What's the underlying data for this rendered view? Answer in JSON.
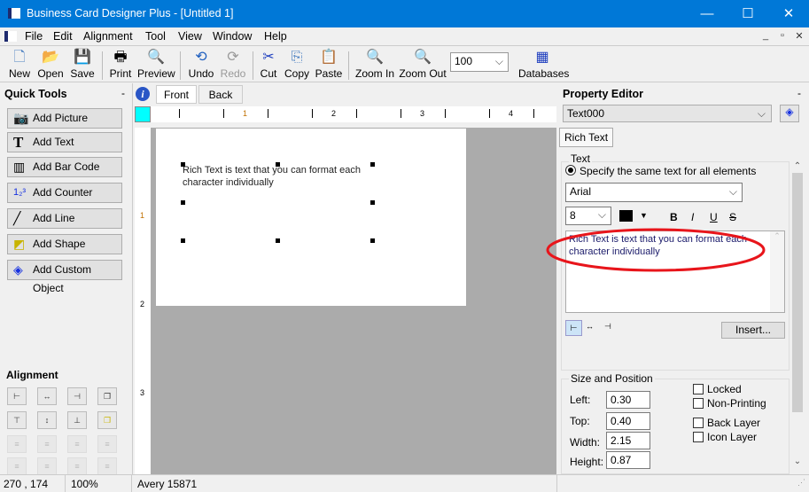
{
  "window": {
    "title": "Business Card Designer Plus  - [Untitled 1]",
    "minimize": "—",
    "maximize": "☐",
    "close": "✕"
  },
  "menu": [
    "File",
    "Edit",
    "Alignment",
    "Tool",
    "View",
    "Window",
    "Help"
  ],
  "mdi_controls": [
    "_",
    "▫",
    "✕"
  ],
  "toolbar": {
    "buttons": [
      {
        "label": "New",
        "icon": "new-file-icon"
      },
      {
        "label": "Open",
        "icon": "open-folder-icon"
      },
      {
        "label": "Save",
        "icon": "save-disk-icon"
      },
      {
        "label": "Print",
        "icon": "printer-icon"
      },
      {
        "label": "Preview",
        "icon": "preview-icon"
      },
      {
        "label": "Undo",
        "icon": "undo-icon"
      },
      {
        "label": "Redo",
        "icon": "redo-icon",
        "disabled": true
      },
      {
        "label": "Cut",
        "icon": "scissors-icon"
      },
      {
        "label": "Copy",
        "icon": "copy-icon"
      },
      {
        "label": "Paste",
        "icon": "paste-icon"
      },
      {
        "label": "Zoom In",
        "icon": "zoom-in-icon"
      },
      {
        "label": "Zoom Out",
        "icon": "zoom-out-icon"
      },
      {
        "label": "Databases",
        "icon": "database-icon"
      }
    ],
    "zoom_value": "100"
  },
  "quick_tools": {
    "title": "Quick Tools",
    "collapse": "-",
    "buttons": [
      "Add Picture",
      "Add Text",
      "Add Bar Code",
      "Add Counter",
      "Add Line",
      "Add Shape",
      "Add Custom Object"
    ],
    "alignment_title": "Alignment"
  },
  "canvas": {
    "tabs": [
      "Front",
      "Back"
    ],
    "active_tab": "Front",
    "ruler_h": [
      "1",
      "2",
      "3",
      "4"
    ],
    "ruler_v": [
      "1",
      "2",
      "3"
    ],
    "text": "Rich Text is text that you can format each character individually"
  },
  "property_editor": {
    "title": "Property Editor",
    "collapse": "-",
    "object": "Text000",
    "tab": "Rich Text",
    "text_group": "Text",
    "radio_label": "Specify the same text for all elements",
    "font": "Arial",
    "size": "8",
    "bold": "B",
    "italic": "I",
    "underline": "U",
    "strike": "S",
    "text_value": "Rich Text is text that you can format each character individually",
    "insert": "Insert...",
    "highlight_color": "#e8151b",
    "size_group": "Size and Position",
    "fields": [
      {
        "label": "Left:",
        "value": "0.30"
      },
      {
        "label": "Top:",
        "value": "0.40"
      },
      {
        "label": "Width:",
        "value": "2.15"
      },
      {
        "label": "Height:",
        "value": "0.87"
      }
    ],
    "checkboxes": [
      {
        "label": "Locked",
        "checked": false
      },
      {
        "label": "Non-Printing",
        "checked": false
      },
      {
        "label": "Back Layer",
        "checked": false
      },
      {
        "label": "Icon Layer",
        "checked": false
      }
    ]
  },
  "status": {
    "coords": "270 , 174",
    "zoom": "100%",
    "stock": "Avery 15871"
  }
}
